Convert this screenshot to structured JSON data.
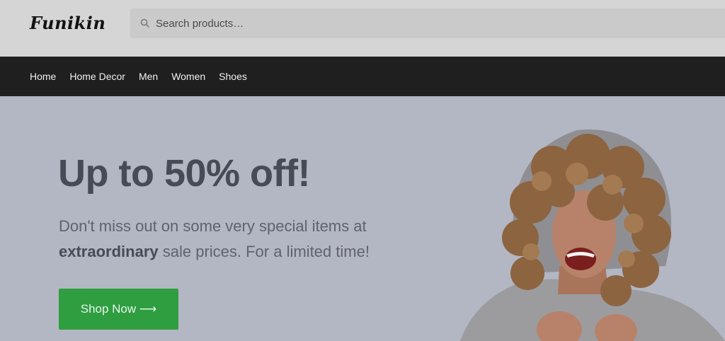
{
  "header": {
    "logo": "Funikin",
    "search": {
      "placeholder": "Search products…"
    }
  },
  "nav": {
    "items": [
      "Home",
      "Home Decor",
      "Men",
      "Women",
      "Shoes"
    ]
  },
  "hero": {
    "heading": "Up to 50% off!",
    "sub_line1": "Don't miss out on some very special items at",
    "sub_bold": "extraordinary",
    "sub_line2_rest": " sale prices. For a limited time!",
    "button_label": "Shop Now ⟶",
    "image_alt": "laughing woman with curly hair"
  },
  "colors": {
    "header_bg": "#d5d5d5",
    "nav_bg": "#1f1f1f",
    "hero_bg": "#b3b6c3",
    "button_bg": "#2e9e41"
  }
}
